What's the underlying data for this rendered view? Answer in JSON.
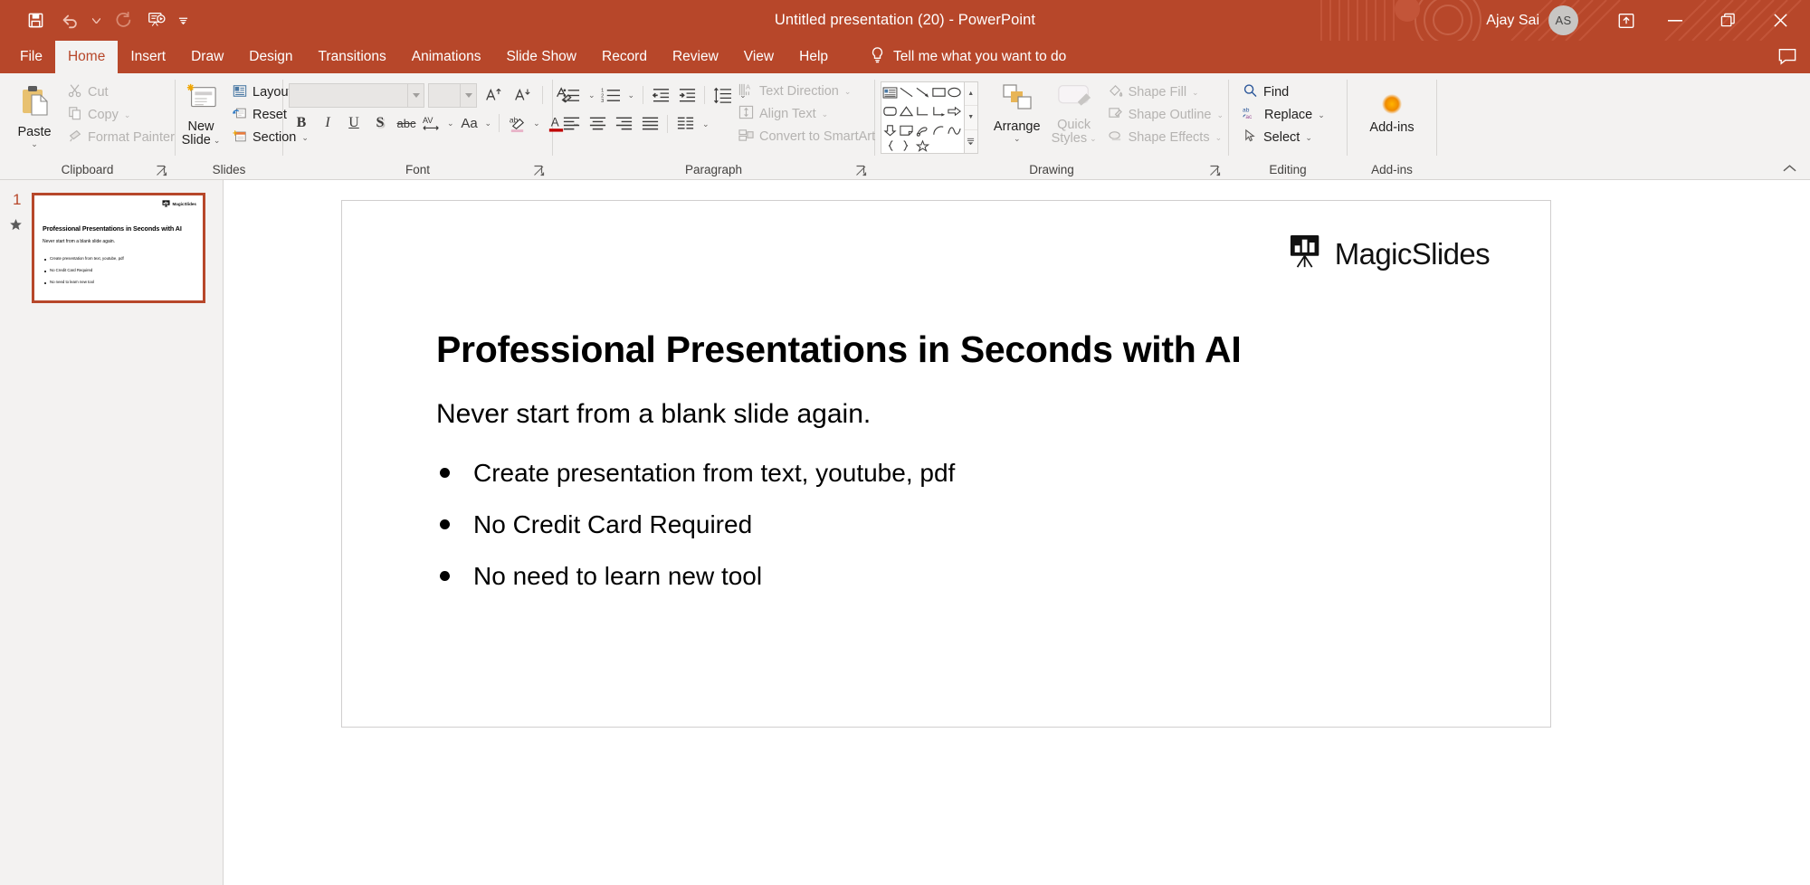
{
  "window": {
    "title": "Untitled presentation (20)  -  PowerPoint",
    "user_name": "Ajay Sai",
    "avatar_initials": "AS",
    "accent_color": "#b7472a",
    "ribbon_bg": "#f3f2f1"
  },
  "quick_access": [
    {
      "name": "save-icon",
      "tooltip": "Save"
    },
    {
      "name": "undo-icon",
      "tooltip": "Undo"
    },
    {
      "name": "undo-dropdown-caret",
      "tooltip": "Undo options"
    },
    {
      "name": "redo-icon",
      "tooltip": "Redo"
    },
    {
      "name": "start-from-beginning-icon",
      "tooltip": "Start From Beginning"
    },
    {
      "name": "customize-qat-caret",
      "tooltip": "Customize Quick Access Toolbar"
    }
  ],
  "window_controls": [
    {
      "name": "ribbon-display-options-icon",
      "glyph": "ribbon-options"
    },
    {
      "name": "minimize-button",
      "glyph": "minimize"
    },
    {
      "name": "restore-button",
      "glyph": "restore"
    },
    {
      "name": "close-button",
      "glyph": "close"
    }
  ],
  "tabs": [
    {
      "label": "File",
      "active": false
    },
    {
      "label": "Home",
      "active": true
    },
    {
      "label": "Insert",
      "active": false
    },
    {
      "label": "Draw",
      "active": false
    },
    {
      "label": "Design",
      "active": false
    },
    {
      "label": "Transitions",
      "active": false
    },
    {
      "label": "Animations",
      "active": false
    },
    {
      "label": "Slide Show",
      "active": false
    },
    {
      "label": "Record",
      "active": false
    },
    {
      "label": "Review",
      "active": false
    },
    {
      "label": "View",
      "active": false
    },
    {
      "label": "Help",
      "active": false
    }
  ],
  "tell_me": {
    "label": "Tell me what you want to do",
    "icon": "lightbulb-icon"
  },
  "ribbon": {
    "clipboard": {
      "label": "Clipboard",
      "paste_label": "Paste",
      "items": [
        {
          "label": "Cut",
          "icon": "scissors-icon",
          "disabled": true
        },
        {
          "label": "Copy",
          "icon": "copy-icon",
          "disabled": true,
          "has_caret": true
        },
        {
          "label": "Format Painter",
          "icon": "format-painter-icon",
          "disabled": true
        }
      ]
    },
    "slides": {
      "label": "Slides",
      "new_slide_label": "New\nSlide",
      "new_slide_line1": "New",
      "new_slide_line2": "Slide",
      "items": [
        {
          "label": "Layout",
          "icon": "layout-icon",
          "has_caret": true
        },
        {
          "label": "Reset",
          "icon": "reset-icon",
          "has_caret": false
        },
        {
          "label": "Section",
          "icon": "section-icon",
          "has_caret": true
        }
      ]
    },
    "font": {
      "label": "Font",
      "font_name_value": "",
      "font_size_value": "",
      "buttons": [
        {
          "name": "increase-font-size-button",
          "glyph": "A↑"
        },
        {
          "name": "decrease-font-size-button",
          "glyph": "A↓"
        },
        {
          "name": "clear-formatting-button",
          "glyph": "clear-format"
        },
        {
          "name": "bold-button",
          "glyph": "B"
        },
        {
          "name": "italic-button",
          "glyph": "I"
        },
        {
          "name": "underline-button",
          "glyph": "U"
        },
        {
          "name": "text-shadow-button",
          "glyph": "S"
        },
        {
          "name": "strikethrough-button",
          "glyph": "abc"
        },
        {
          "name": "character-spacing-button",
          "glyph": "AV"
        },
        {
          "name": "change-case-button",
          "glyph": "Aa"
        },
        {
          "name": "text-highlight-color-button",
          "glyph": "highlight"
        },
        {
          "name": "font-color-button",
          "glyph": "A"
        }
      ]
    },
    "paragraph": {
      "label": "Paragraph",
      "buttons": [
        {
          "name": "bullets-button",
          "glyph": "bullets"
        },
        {
          "name": "numbering-button",
          "glyph": "numbering"
        },
        {
          "name": "decrease-indent-button",
          "glyph": "decrease-indent"
        },
        {
          "name": "increase-indent-button",
          "glyph": "increase-indent"
        },
        {
          "name": "line-spacing-button",
          "glyph": "line-spacing"
        },
        {
          "name": "align-left-button",
          "glyph": "align-left"
        },
        {
          "name": "align-center-button",
          "glyph": "align-center"
        },
        {
          "name": "align-right-button",
          "glyph": "align-right"
        },
        {
          "name": "justify-button",
          "glyph": "justify"
        },
        {
          "name": "columns-button",
          "glyph": "columns"
        }
      ],
      "items": [
        {
          "label": "Text Direction",
          "icon": "text-direction-icon",
          "disabled": true,
          "has_caret": true
        },
        {
          "label": "Align Text",
          "icon": "align-text-icon",
          "disabled": true,
          "has_caret": true
        },
        {
          "label": "Convert to SmartArt",
          "icon": "smartart-icon",
          "disabled": true,
          "has_caret": true
        }
      ]
    },
    "drawing": {
      "label": "Drawing",
      "arrange_label": "Arrange",
      "quick_styles_line1": "Quick",
      "quick_styles_line2": "Styles",
      "shapes": [
        "text-box-shape",
        "line-shape",
        "arrow-shape",
        "rectangle-shape",
        "oval-shape",
        "rounded-rectangle-shape",
        "triangle-shape",
        "elbow-connector-shape",
        "elbow-arrow-connector-shape",
        "right-arrow-shape",
        "down-arrow-shape",
        "folded-corner-shape",
        "scribble-shape",
        "arc-shape",
        "curve-shape",
        "left-brace-shape",
        "right-brace-shape",
        "star-shape"
      ],
      "items": [
        {
          "label": "Shape Fill",
          "icon": "shape-fill-icon",
          "disabled": true,
          "has_caret": true
        },
        {
          "label": "Shape Outline",
          "icon": "shape-outline-icon",
          "disabled": true,
          "has_caret": true
        },
        {
          "label": "Shape Effects",
          "icon": "shape-effects-icon",
          "disabled": true,
          "has_caret": true
        }
      ]
    },
    "editing": {
      "label": "Editing",
      "items": [
        {
          "label": "Find",
          "icon": "search-icon",
          "disabled": false,
          "has_caret": false
        },
        {
          "label": "Replace",
          "icon": "replace-icon",
          "disabled": false,
          "has_caret": true
        },
        {
          "label": "Select",
          "icon": "select-cursor-icon",
          "disabled": false,
          "has_caret": true
        }
      ]
    },
    "addins": {
      "label": "Add-ins",
      "button_label": "Add-ins",
      "icon": "addins-dot-icon"
    }
  },
  "slide_panel": {
    "thumbnail_number": "1",
    "star_icon": "animation-star-icon"
  },
  "slide": {
    "logo_text": "MagicSlides",
    "logo_icon": "magicslides-easel-icon",
    "title": "Professional Presentations in Seconds with AI",
    "subtitle": "Never start from a blank slide again.",
    "bullets": [
      "Create presentation from text, youtube, pdf",
      "No Credit Card Required",
      "No need to learn new tool"
    ]
  }
}
